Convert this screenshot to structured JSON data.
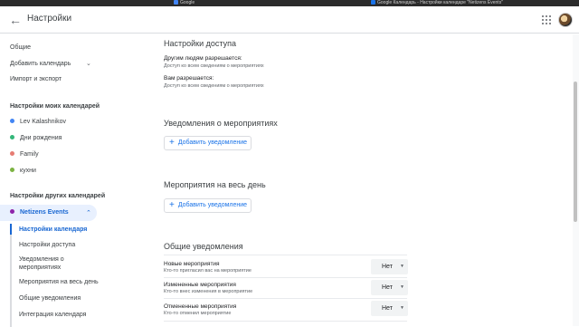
{
  "browser": {
    "tabs": [
      {
        "label": "Google",
        "color": "#4285f4"
      },
      {
        "label": "Google Календарь - Настройки календаре \"Netizens Events\"",
        "color": "#1a73e8"
      }
    ],
    "dot_colors": [
      "#ea4335",
      "#ea4335",
      "#ea4335",
      "#ea4335"
    ]
  },
  "appbar": {
    "title": "Настройки",
    "back_icon": "arrow-left-icon",
    "apps_icon": "grid-apps-icon"
  },
  "sidebar": {
    "general": "Общие",
    "add_calendar": "Добавить календарь",
    "import_export": "Импорт и экспорт",
    "my_calendars_header": "Настройки моих календарей",
    "my_calendars": [
      {
        "label": "Lev Kalashnikov",
        "color": "#4285f4"
      },
      {
        "label": "Дни рождения",
        "color": "#33b679"
      },
      {
        "label": "Family",
        "color": "#e67c73"
      },
      {
        "label": "кухни",
        "color": "#7cb342"
      }
    ],
    "other_calendars_header": "Настройки других календарей",
    "active_calendar": {
      "label": "Netizens Events",
      "color": "#8e24aa"
    },
    "subnav": [
      "Настройки календаря",
      "Настройки доступа",
      "Уведомления о мероприятиях",
      "Мероприятия на весь день",
      "Общие уведомления",
      "Интеграция календаря"
    ]
  },
  "main": {
    "access": {
      "title": "Настройки доступа",
      "others_label": "Другим людям разрешается:",
      "others_value": "Доступ ко всем сведениям о мероприятиях",
      "you_label": "Вам разрешается:",
      "you_value": "Доступ ко всем сведениям о мероприятиях"
    },
    "event_notifications": {
      "title": "Уведомления о мероприятиях",
      "add_label": "Добавить уведомление"
    },
    "allday": {
      "title": "Мероприятия на весь день",
      "add_label": "Добавить уведомление"
    },
    "general_notifications": {
      "title": "Общие уведомления",
      "rows": [
        {
          "label": "Новые мероприятия",
          "sub": "Кто-то пригласил вас на мероприятие",
          "value": "Нет"
        },
        {
          "label": "Измененные мероприятия",
          "sub": "Кто-то внес изменения в мероприятие",
          "value": "Нет"
        },
        {
          "label": "Отмененные мероприятия",
          "sub": "Кто-то отменил мероприятие",
          "value": "Нет"
        }
      ]
    }
  }
}
